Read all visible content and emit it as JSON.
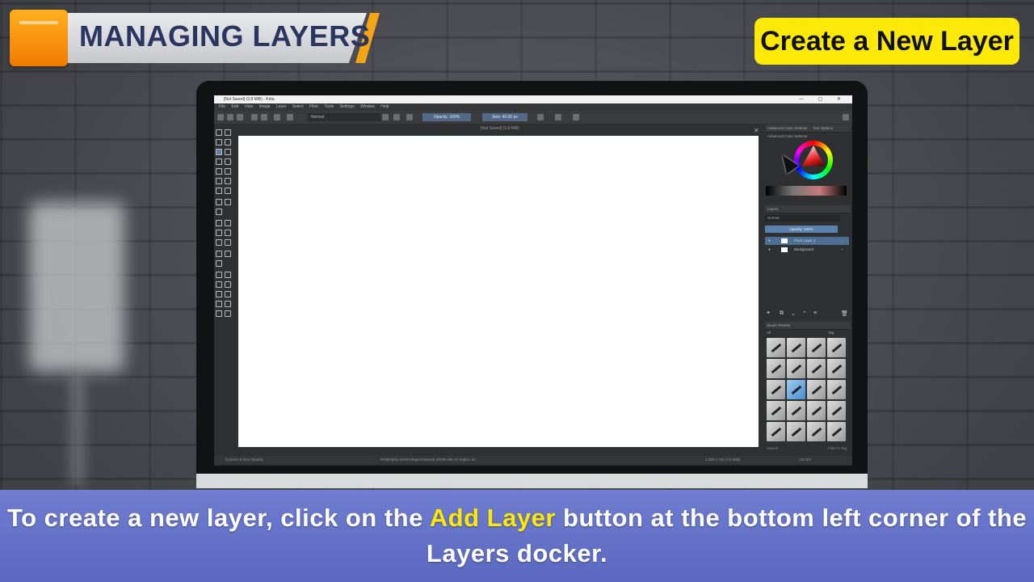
{
  "header": {
    "title": "MANAGING LAYERS"
  },
  "topic": {
    "label": "Create a New Layer"
  },
  "subtitle": {
    "line1_before": "To create a new layer, click on the ",
    "line1_highlight": "Add Layer",
    "line1_after": " button at the bottom left corner of the",
    "line2": "Layers docker."
  },
  "krita": {
    "window_title": "[Not Saved] (3.8 MiB) - Krita",
    "window_controls": "— ▢ ✕",
    "menu": [
      "File",
      "Edit",
      "View",
      "Image",
      "Layer",
      "Select",
      "Filter",
      "Tools",
      "Settings",
      "Window",
      "Help"
    ],
    "blend_mode": "Normal",
    "opacity": "Opacity: 100%",
    "size": "Size: 40.00 px",
    "doc_tab": "[Not Saved] (3.8 MiB)",
    "docker_tabs": [
      "Advanced Color Selector",
      "Tool Options"
    ],
    "color_selector_title": "Advanced Color Selector",
    "layers": {
      "title": "Layers",
      "blend": "Normal",
      "opacity": "Opacity: 100%",
      "rows": [
        {
          "name": "Paint Layer 1",
          "selected": true
        },
        {
          "name": "Background",
          "selected": false
        }
      ]
    },
    "brush_presets": {
      "title": "Brush Presets",
      "tag_filter": "All",
      "tag_label": "Tag",
      "search": "Search",
      "filter": "Filter in Tag"
    },
    "status": {
      "brush": "b) Basic-5 Size Opacity",
      "color": "RGB/Alpha (8-bit integer/channel)  sRGB-elle-V2-srgbtrc.icc",
      "dims": "1,280 x 720 (3.8 MiB)",
      "zoom": "122.5%"
    }
  },
  "colors": {
    "accent": "#fde907",
    "subtitle_bg": "#6472c8",
    "header_text": "#2a3560",
    "badge": "#f79410"
  }
}
